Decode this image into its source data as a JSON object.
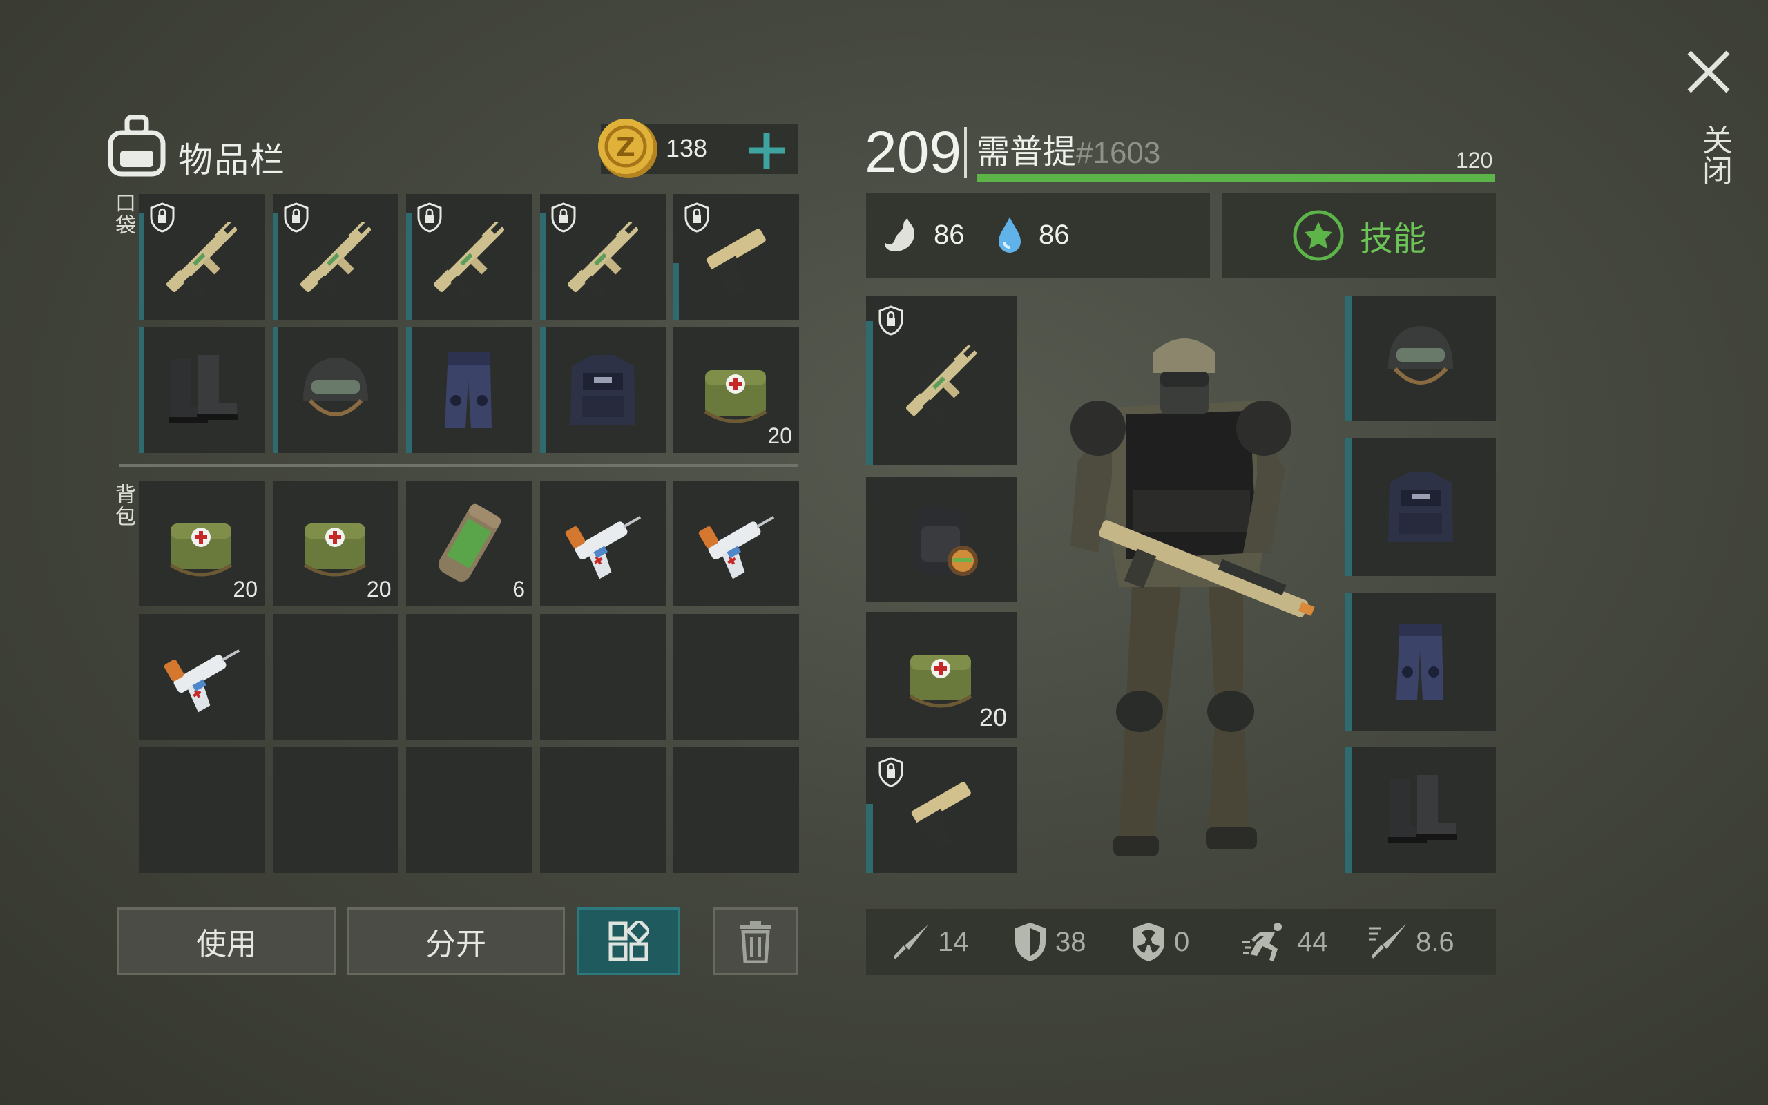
{
  "inventory": {
    "title": "物品栏",
    "coins": "138",
    "pocket_label": "口袋",
    "backpack_label": "背包",
    "pocket": [
      {
        "item": "assault-rifle",
        "count": "",
        "locked": true,
        "dur": 0.85
      },
      {
        "item": "assault-rifle",
        "count": "",
        "locked": true,
        "dur": 0.85
      },
      {
        "item": "assault-rifle",
        "count": "",
        "locked": true,
        "dur": 0.85
      },
      {
        "item": "assault-rifle",
        "count": "",
        "locked": true,
        "dur": 0.85
      },
      {
        "item": "pistol",
        "count": "",
        "locked": true,
        "dur": 0.45
      },
      {
        "item": "boots",
        "count": "",
        "locked": false,
        "dur": 1.0
      },
      {
        "item": "helmet",
        "count": "",
        "locked": false,
        "dur": 1.0
      },
      {
        "item": "pants",
        "count": "",
        "locked": false,
        "dur": 1.0
      },
      {
        "item": "vest",
        "count": "",
        "locked": false,
        "dur": 1.0
      },
      {
        "item": "medkit",
        "count": "20",
        "locked": false,
        "dur": 0
      }
    ],
    "backpack": [
      {
        "item": "medkit",
        "count": "20"
      },
      {
        "item": "medkit",
        "count": "20"
      },
      {
        "item": "canister",
        "count": "6"
      },
      {
        "item": "syringe-gun",
        "count": ""
      },
      {
        "item": "syringe-gun",
        "count": ""
      },
      {
        "item": "syringe-gun",
        "count": ""
      },
      {
        "item": "",
        "count": ""
      },
      {
        "item": "",
        "count": ""
      },
      {
        "item": "",
        "count": ""
      },
      {
        "item": "",
        "count": ""
      },
      {
        "item": "",
        "count": ""
      },
      {
        "item": "",
        "count": ""
      },
      {
        "item": "",
        "count": ""
      },
      {
        "item": "",
        "count": ""
      },
      {
        "item": "",
        "count": ""
      }
    ],
    "use_label": "使用",
    "split_label": "分开"
  },
  "character": {
    "level": "209",
    "name": "需普提",
    "id": "#1603",
    "xp_value": "120",
    "xp_fraction": 1.0,
    "hunger": "86",
    "thirst": "86",
    "skills_label": "技能",
    "left_equip": [
      {
        "item": "assault-rifle",
        "count": "",
        "locked": true,
        "dur": 0.85
      },
      {
        "item": "backpack",
        "count": "",
        "locked": false,
        "dur": 0
      },
      {
        "item": "medkit",
        "count": "20",
        "locked": false,
        "dur": 0
      },
      {
        "item": "pistol",
        "count": "",
        "locked": true,
        "dur": 0.55
      }
    ],
    "right_equip": [
      {
        "item": "helmet",
        "dur": 1.0
      },
      {
        "item": "vest",
        "dur": 1.0
      },
      {
        "item": "pants",
        "dur": 1.0
      },
      {
        "item": "boots",
        "dur": 1.0
      }
    ],
    "stats": {
      "attack": "14",
      "defense": "38",
      "radiation": "0",
      "speed": "44",
      "crit": "8.6"
    }
  },
  "close_label": "关闭",
  "colors": {
    "accent_green": "#5db54a",
    "teal": "#2f6b6e",
    "coin": "#d4a431"
  }
}
